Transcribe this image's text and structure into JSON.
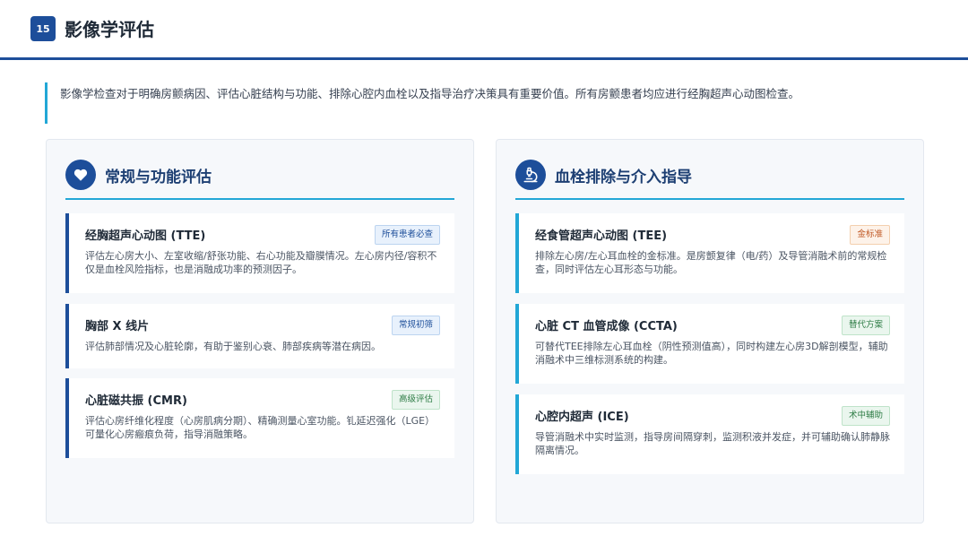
{
  "header": {
    "page_number": "15",
    "title": "影像学评估",
    "accent_color": "#1d4e9a"
  },
  "intro": {
    "text": "影像学检查对于明确房颤病因、评估心脏结构与功能、排除心腔内血栓以及指导治疗决策具有重要价值。所有房颤患者均应进行经胸超声心动图检查。"
  },
  "left_panel": {
    "icon": "heart-icon",
    "title": "常规与功能评估",
    "cards": [
      {
        "title": "经胸超声心动图 (TTE)",
        "tag": "所有患者必查",
        "desc": "评估左心房大小、左室收缩/舒张功能、右心功能及瓣膜情况。左心房内径/容积不仅是血栓风险指标，也是消融成功率的预测因子。"
      },
      {
        "title": "胸部 X 线片",
        "tag": "常规初筛",
        "desc": "评估肺部情况及心脏轮廓，有助于鉴别心衰、肺部疾病等潜在病因。"
      },
      {
        "title": "心脏磁共振 (CMR)",
        "tag": "高级评估",
        "desc": "评估心房纤维化程度（心房肌病分期）、精确测量心室功能。钆延迟强化（LGE）可量化心房瘢痕负荷，指导消融策略。"
      }
    ]
  },
  "right_panel": {
    "icon": "microscope-icon",
    "title": "血栓排除与介入指导",
    "cards": [
      {
        "title": "经食管超声心动图 (TEE)",
        "tag": "金标准",
        "desc": "排除左心房/左心耳血栓的金标准。是房颤复律（电/药）及导管消融术前的常规检查，同时评估左心耳形态与功能。"
      },
      {
        "title": "心脏 CT 血管成像 (CCTA)",
        "tag": "替代方案",
        "desc": "可替代TEE排除左心耳血栓（阴性预测值高），同时构建左心房3D解剖模型，辅助消融术中三维标测系统的构建。"
      },
      {
        "title": "心腔内超声 (ICE)",
        "tag": "术中辅助",
        "desc": "导管消融术中实时监测，指导房间隔穿刺，监测积液并发症，并可辅助确认肺静脉隔离情况。"
      }
    ]
  }
}
